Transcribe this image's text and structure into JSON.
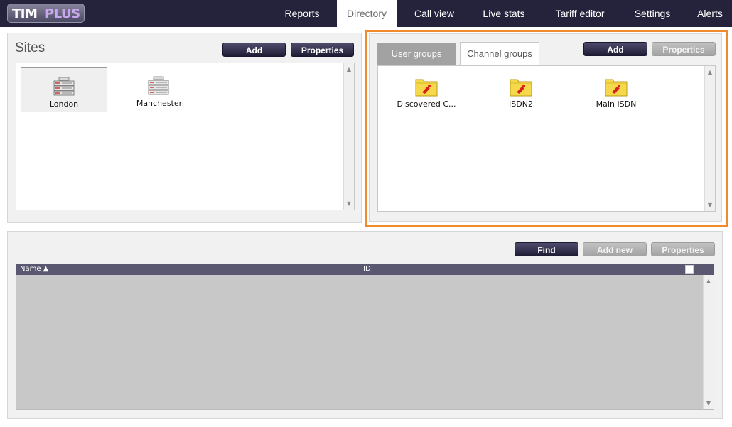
{
  "app": {
    "logo_tim": "TIM",
    "logo_plus": "PLUS"
  },
  "nav": {
    "items": [
      {
        "label": "Reports"
      },
      {
        "label": "Directory"
      },
      {
        "label": "Call view"
      },
      {
        "label": "Live stats"
      },
      {
        "label": "Tariff editor"
      },
      {
        "label": "Settings"
      },
      {
        "label": "Alerts"
      }
    ],
    "active": "Directory"
  },
  "sites": {
    "title": "Sites",
    "add_label": "Add",
    "properties_label": "Properties",
    "items": [
      {
        "label": "London",
        "selected": true
      },
      {
        "label": "Manchester",
        "selected": false
      }
    ]
  },
  "groups": {
    "tabs": [
      {
        "label": "User groups",
        "active": false
      },
      {
        "label": "Channel groups",
        "active": true
      }
    ],
    "add_label": "Add",
    "properties_label": "Properties",
    "items": [
      {
        "label": "Discovered C..."
      },
      {
        "label": "ISDN2"
      },
      {
        "label": "Main ISDN"
      }
    ]
  },
  "directory": {
    "find_label": "Find",
    "add_new_label": "Add new",
    "properties_label": "Properties",
    "columns": {
      "name": "Name ▲",
      "id": "ID"
    },
    "rows": []
  },
  "colors": {
    "nav_bg": "#25233c",
    "highlight": "#f08a2c",
    "button_dark": "#2e2c48",
    "button_grey": "#aaaaaa",
    "table_header": "#5a5871"
  }
}
